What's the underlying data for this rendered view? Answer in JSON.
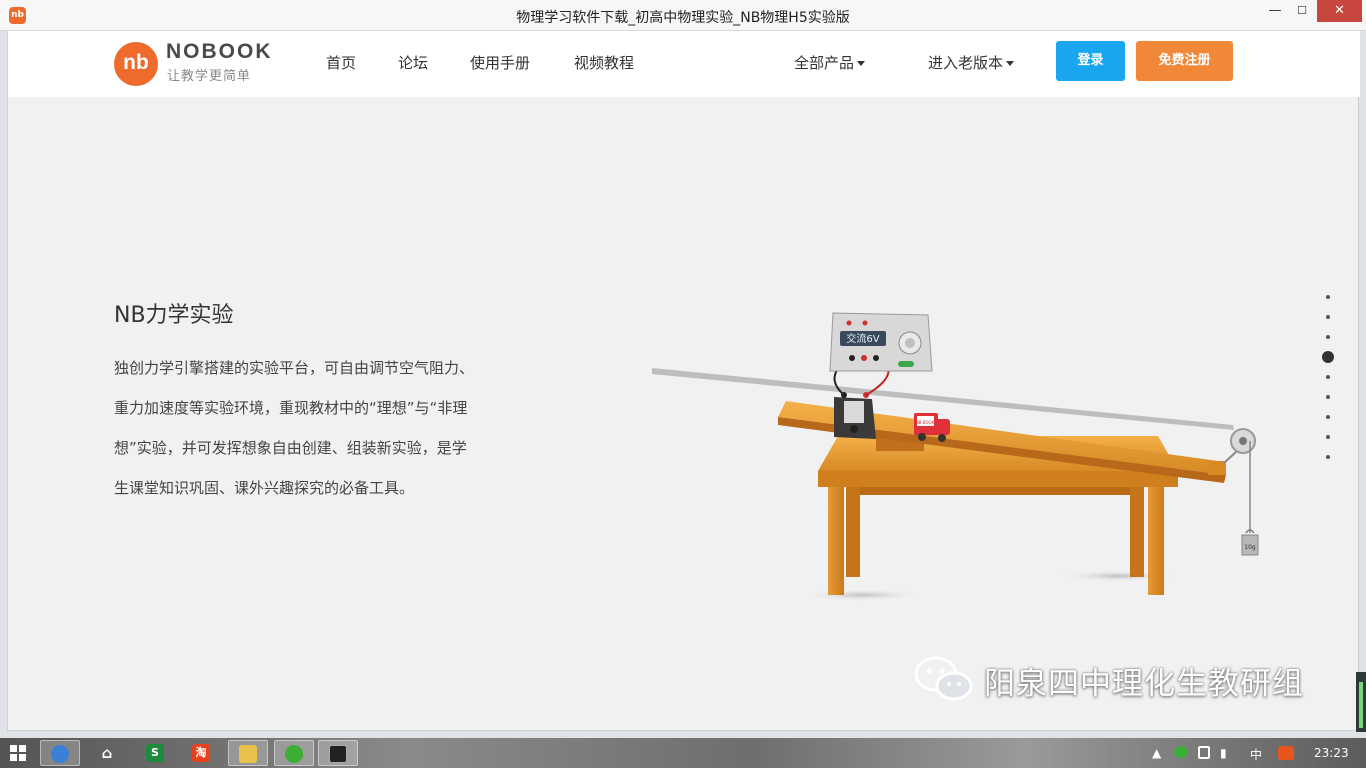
{
  "window": {
    "title": "物理学习软件下载_初高中物理实验_NB物理H5实验版",
    "app_icon_text": "nb",
    "minimize_glyph": "—",
    "maximize_glyph": "☐",
    "close_glyph": "✕"
  },
  "site": {
    "logo_mark": "nb",
    "logo_text": "NOBOOK",
    "logo_tagline": "让教学更简单",
    "nav": {
      "home": "首页",
      "forum": "论坛",
      "manual": "使用手册",
      "video": "视频教程",
      "products": "全部产品",
      "old_version": "进入老版本"
    },
    "buttons": {
      "login": "登录",
      "register": "免费注册"
    },
    "colors": {
      "brand": "#ee6b2d",
      "login": "#1aa6ef",
      "register": "#f08838"
    }
  },
  "feature": {
    "title": "NB力学实验",
    "description": "独创力学引擎搭建的实验平台，可自由调节空气阻力、重力加速度等实验环境，重现教材中的“理想”与“非理想”实验，并可发挥想象自由创建、组装新实验，是学生课堂知识巩固、课外兴趣探究的必备工具。"
  },
  "illustration": {
    "power_supply_display": "交流6V",
    "weight_label": "10g",
    "cart_label": "NB BOOK"
  },
  "pagination": {
    "total": 9,
    "active": 4
  },
  "watermark": {
    "text": "阳泉四中理化生教研组"
  },
  "taskbar": {
    "apps": [
      "start",
      "sogou-browser",
      "home",
      "wps-spreadsheet",
      "taobao",
      "file-explorer",
      "wechat",
      "nobook"
    ],
    "ime": "中",
    "time": "23:23"
  }
}
